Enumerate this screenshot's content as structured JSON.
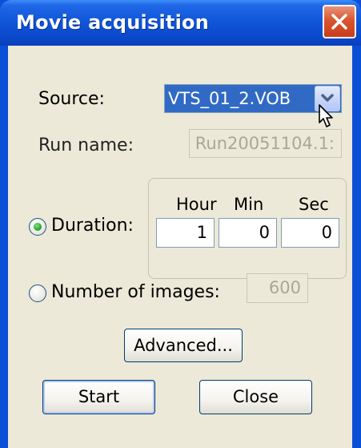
{
  "window": {
    "title": "Movie acquisition"
  },
  "source": {
    "label": "Source:",
    "value": "VTS_01_2.VOB"
  },
  "run_name": {
    "label": "Run name:",
    "value": "Run20051104.1:"
  },
  "duration": {
    "label": "Duration:",
    "selected": true,
    "columns": [
      "Hour",
      "Min",
      "Sec"
    ],
    "values": [
      "1",
      "0",
      "0"
    ]
  },
  "num_images": {
    "label": "Number of images:",
    "selected": false,
    "value": "600"
  },
  "buttons": {
    "advanced": "Advanced...",
    "start": "Start",
    "close": "Close"
  },
  "icons": {
    "close": "close-x-icon",
    "dropdown": "chevron-down-icon",
    "cursor": "mouse-pointer-icon",
    "radio": "radio-button-icon"
  },
  "colors": {
    "titlebar": "#0a47c9",
    "selection": "#316ac5",
    "close_button": "#d9562f",
    "client": "#ece9d8"
  }
}
